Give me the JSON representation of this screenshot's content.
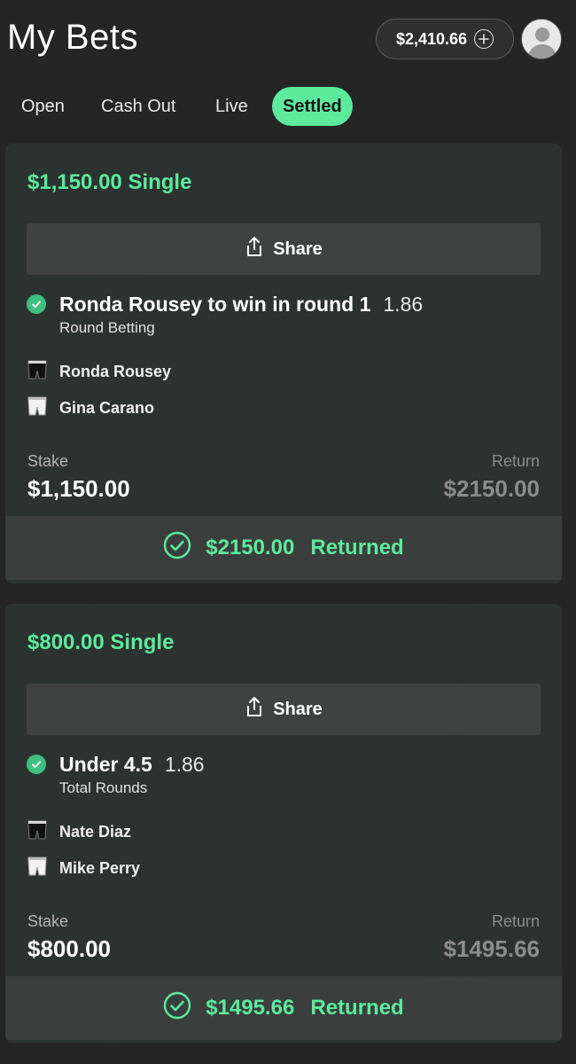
{
  "header": {
    "title": "My Bets",
    "balance": "$2,410.66",
    "add_funds_icon": "plus-circle-icon",
    "avatar_icon": "user-avatar-icon"
  },
  "tabs": [
    {
      "label": "Open",
      "active": false
    },
    {
      "label": "Cash Out",
      "active": false
    },
    {
      "label": "Live",
      "active": false
    },
    {
      "label": "Settled",
      "active": true
    }
  ],
  "colors": {
    "accent": "#5dea9c",
    "background": "#252525",
    "card": "#2c3230",
    "share_button": "#3e4341",
    "check": "#3ebf7f"
  },
  "bets": [
    {
      "title": "$1,150.00 Single",
      "share_label": "Share",
      "selection": "Ronda Rousey to win in round 1",
      "odds": "1.86",
      "market": "Round Betting",
      "fighters": [
        {
          "name": "Ronda Rousey",
          "icon": "black-shorts-icon"
        },
        {
          "name": "Gina Carano",
          "icon": "white-shorts-icon"
        }
      ],
      "stake_label": "Stake",
      "stake": "$1,150.00",
      "return_label": "Return",
      "return_value": "$2150.00",
      "returned_amount": "$2150.00",
      "returned_label": "Returned"
    },
    {
      "title": "$800.00 Single",
      "share_label": "Share",
      "selection": "Under 4.5",
      "odds": "1.86",
      "market": "Total Rounds",
      "fighters": [
        {
          "name": "Nate Diaz",
          "icon": "black-shorts-icon"
        },
        {
          "name": "Mike Perry",
          "icon": "white-shorts-icon"
        }
      ],
      "stake_label": "Stake",
      "stake": "$800.00",
      "return_label": "Return",
      "return_value": "$1495.66",
      "returned_amount": "$1495.66",
      "returned_label": "Returned"
    }
  ]
}
